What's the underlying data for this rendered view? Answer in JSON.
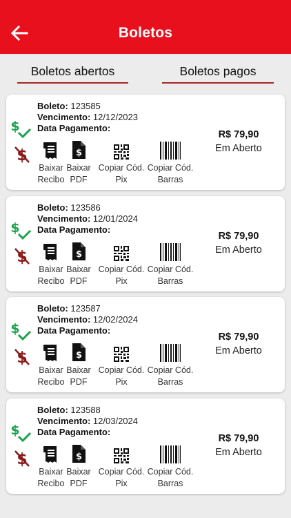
{
  "header": {
    "title": "Boletos"
  },
  "tabs": [
    {
      "label": "Boletos abertos"
    },
    {
      "label": "Boletos pagos"
    }
  ],
  "labels": {
    "boleto": "Boleto:",
    "vencimento": "Vencimento:",
    "data_pagamento": "Data Pagamento:"
  },
  "actions": [
    {
      "line1": "Baixar",
      "line2": "Recibo",
      "icon": "receipt-icon"
    },
    {
      "line1": "Baixar",
      "line2": "PDF",
      "icon": "pdf-dollar-icon"
    },
    {
      "line1": "Copiar Cód.",
      "line2": "Pix",
      "icon": "qr-code-icon"
    },
    {
      "line1": "Copiar Cód.",
      "line2": "Barras",
      "icon": "barcode-icon"
    }
  ],
  "boletos": [
    {
      "numero": "123585",
      "vencimento": "12/12/2023",
      "data_pagamento": "",
      "valor": "R$ 79,90",
      "status": "Em Aberto"
    },
    {
      "numero": "123586",
      "vencimento": "12/01/2024",
      "data_pagamento": "",
      "valor": "R$ 79,90",
      "status": "Em Aberto"
    },
    {
      "numero": "123587",
      "vencimento": "12/02/2024",
      "data_pagamento": "",
      "valor": "R$ 79,90",
      "status": "Em Aberto"
    },
    {
      "numero": "123588",
      "vencimento": "12/03/2024",
      "data_pagamento": "",
      "valor": "R$ 79,90",
      "status": "Em Aberto"
    }
  ],
  "colors": {
    "header": "#e8101c",
    "paid_green": "#1aa34a",
    "unpaid_red": "#8b1a1a",
    "tab_underline": "#a32626"
  }
}
